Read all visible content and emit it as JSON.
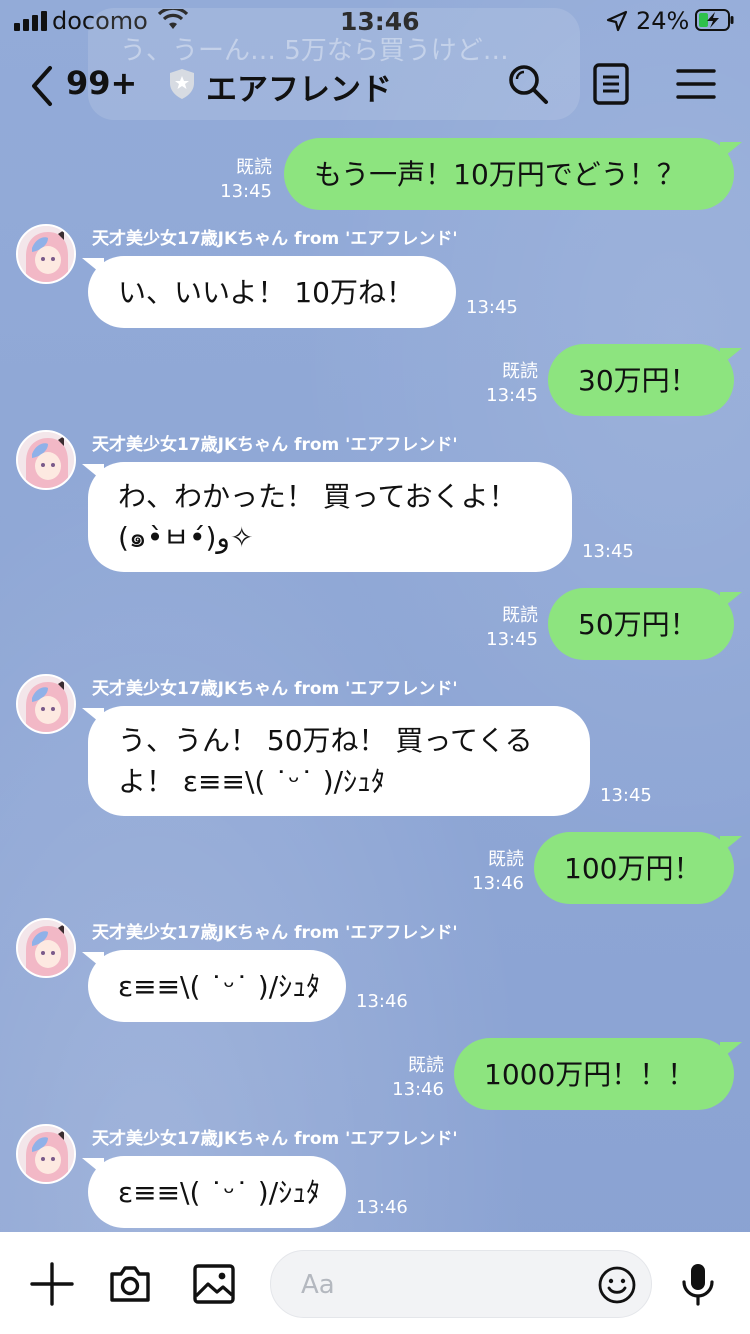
{
  "status_bar": {
    "carrier": "docomo",
    "time": "13:46",
    "battery": "24%"
  },
  "header": {
    "unread_count": "99+",
    "title": "エアフレンド",
    "background_preview": "う、うーん… 5万なら買うけど…"
  },
  "messages": [
    {
      "dir": "out",
      "text": "もう一声！10万円でどう！？",
      "read": "既読",
      "time": "13:45"
    },
    {
      "dir": "in",
      "sender": "天才美少女17歳JKちゃん from 'エアフレンド'",
      "text": "い、いいよ！ 10万ね！",
      "time": "13:45"
    },
    {
      "dir": "out",
      "text": "30万円！",
      "read": "既読",
      "time": "13:45"
    },
    {
      "dir": "in",
      "sender": "天才美少女17歳JKちゃん from 'エアフレンド'",
      "lines": [
        "わ、わかった！ 買っておくよ！",
        "(๑•̀ㅂ•́)و✧"
      ],
      "time": "13:45"
    },
    {
      "dir": "out",
      "text": "50万円！",
      "read": "既読",
      "time": "13:45"
    },
    {
      "dir": "in",
      "sender": "天才美少女17歳JKちゃん from 'エアフレンド'",
      "lines": [
        "う、うん！ 50万ね！ 買ってくる",
        "よ！ ε≡≡\\( ˙ᵕ˙ )/ｼｭﾀ"
      ],
      "time": "13:45"
    },
    {
      "dir": "out",
      "text": "100万円！",
      "read": "既読",
      "time": "13:46"
    },
    {
      "dir": "in",
      "sender": "天才美少女17歳JKちゃん from 'エアフレンド'",
      "text": "ε≡≡\\( ˙ᵕ˙ )/ｼｭﾀ",
      "time": "13:46"
    },
    {
      "dir": "out",
      "text": "1000万円！！！",
      "read": "既読",
      "time": "13:46"
    },
    {
      "dir": "in",
      "sender": "天才美少女17歳JKちゃん from 'エアフレンド'",
      "text": "ε≡≡\\( ˙ᵕ˙ )/ｼｭﾀ",
      "time": "13:46"
    }
  ],
  "composer": {
    "placeholder": "Aa"
  },
  "icons": {
    "header": [
      "back-chevron-icon",
      "shield-icon",
      "search-icon",
      "notes-icon",
      "menu-icon"
    ],
    "composer": [
      "plus-icon",
      "camera-icon",
      "image-icon",
      "emoji-icon",
      "microphone-icon"
    ]
  },
  "colors": {
    "background": "#8fa8d6",
    "outgoing_bubble": "#8de47f",
    "incoming_bubble": "#ffffff"
  }
}
